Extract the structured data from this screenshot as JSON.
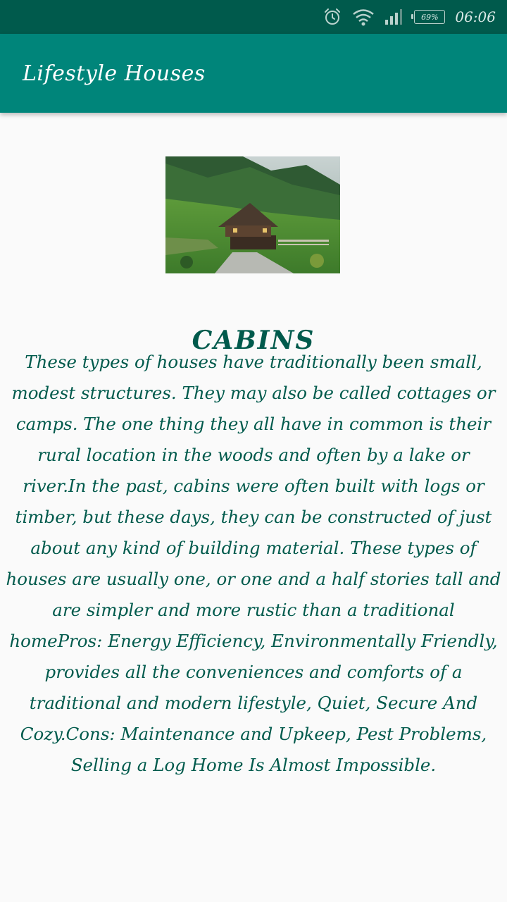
{
  "status_bar": {
    "alarm_icon": "alarm-clock-icon",
    "wifi_icon": "wifi-icon",
    "signal_icon": "cell-signal-icon",
    "battery_percent": "69%",
    "time": "06:06"
  },
  "app_bar": {
    "title": "Lifestyle Houses"
  },
  "main": {
    "image_description_icon": "cabin-photo",
    "section_title": "CABINS",
    "body": "These types of houses have traditionally been small, modest structures. They may also be called cottages or camps. The one thing they all have in common is their rural location in the woods and often by a lake or river.In the past, cabins were often built with logs or timber, but these days, they can be constructed of just about any kind of building material. These types of houses are usually one, or one and a half stories tall and are simpler and more rustic than a traditional homePros: Energy Efficiency, Environmentally Friendly, provides all the conveniences and comforts of a traditional and modern lifestyle, Quiet, Secure And Cozy.Cons: Maintenance and Upkeep, Pest Problems, Selling a Log Home Is Almost Impossible."
  },
  "colors": {
    "status_bar": "#005a4c",
    "app_bar": "#00857a",
    "text": "#005a4c",
    "background": "#fafafa"
  }
}
